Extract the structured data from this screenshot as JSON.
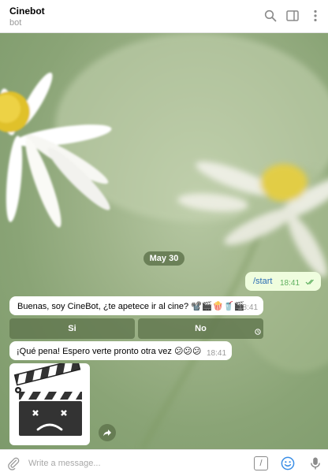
{
  "header": {
    "title": "Cinebot",
    "subtitle": "bot",
    "icons": [
      "search-icon",
      "sidebar-icon",
      "more-icon"
    ]
  },
  "date_separator": "May 30",
  "messages": [
    {
      "direction": "out",
      "text": "/start",
      "time": "18:41",
      "status": "read"
    },
    {
      "direction": "in",
      "text": "Buenas, soy CineBot, ¿te apetece ir al cine? 📽️🎬🍿🥤🎬",
      "time": "18:41"
    },
    {
      "direction": "in",
      "text": "¡Qué pena! Espero verte pronto otra vez 😕😕😕",
      "time": "18:41"
    },
    {
      "direction": "in",
      "type": "sticker",
      "sticker": "sad-clapperboard"
    }
  ],
  "keyboard": {
    "buttons": [
      "Si",
      "No"
    ]
  },
  "composer": {
    "placeholder": "Write a message..."
  },
  "colors": {
    "accent": "#2a6cb3",
    "outgoing_bubble": "#effdde",
    "check_green": "#5fb05f",
    "overlay": "#60764e"
  }
}
